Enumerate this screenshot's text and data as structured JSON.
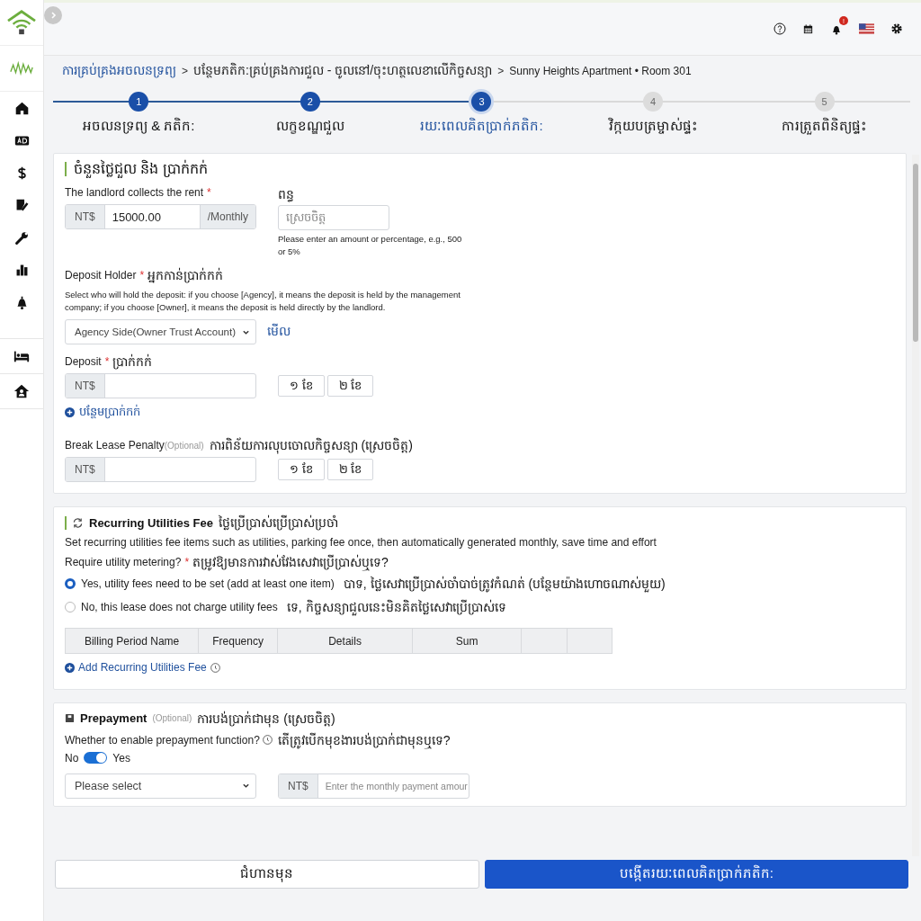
{
  "topbar": {
    "notification_badge": "!"
  },
  "breadcrumb": {
    "separator": ">",
    "items": [
      "ការគ្រប់គ្រងអចលនទ្រព្យ",
      "បន្ថែមភតិក:គ្រប់គ្រងការជួល - ចូលនៅ/ចុះហត្ថលេខាលើកិច្ចសន្យា",
      "Sunny Heights Apartment • Room 301"
    ]
  },
  "steps": [
    {
      "number": "1",
      "label": "អចលនទ្រព្យ & ភតិក:",
      "completed": true,
      "selected": false
    },
    {
      "number": "2",
      "label": "លក្ខខណ្ឌជួល",
      "completed": true,
      "selected": false
    },
    {
      "number": "3",
      "label": "រយៈពេលគិតប្រាក់ភតិក:",
      "completed": true,
      "selected": true
    },
    {
      "number": "4",
      "label": "វិក្កយបត្រម្ចាស់ផ្ទះ",
      "completed": false,
      "selected": false
    },
    {
      "number": "5",
      "label": "ការត្រួតពិនិត្យផ្ទះ",
      "completed": false,
      "selected": false
    }
  ],
  "rent_section": {
    "title": "ចំនួនថ្លៃជួល និង ប្រាក់កក់",
    "rent": {
      "label": "The landlord collects the rent",
      "mark": "*",
      "prefix": "NT$",
      "value": "15000.00",
      "suffix": "/Monthly"
    },
    "tax": {
      "label": "ពន្ធ",
      "placeholder": "ស្រេចចិត្ត",
      "hint": "Please enter an amount or percentage, e.g., 500 or 5%"
    },
    "deposit_holder": {
      "label": "Deposit Holder",
      "mark": "*",
      "label_km": "អ្នកកាន់ប្រាក់កក់",
      "description": "Select who will hold the deposit: if you choose [Agency], it means the deposit is held by the management company; if you choose [Owner], it means the deposit is held directly by the landlord.",
      "value": "Agency Side(Owner Trust Account)",
      "link": "មើល"
    },
    "deposit": {
      "label": "Deposit",
      "mark": "*",
      "label_km": "ប្រាក់កក់",
      "prefix": "NT$",
      "quick": [
        "១ ខែ",
        "២ ខែ"
      ],
      "add_link": "បន្ថែមប្រាក់កក់"
    },
    "penalty": {
      "label": "Break Lease Penalty",
      "optional": "(Optional)",
      "label_km": "ការពិន័យការលុបចោលកិច្ចសន្យា (ស្រេចចិត្ត)",
      "prefix": "NT$",
      "quick": [
        "១ ខែ",
        "២ ខែ"
      ]
    }
  },
  "utilities_section": {
    "title": "Recurring Utilities Fee",
    "title_km": "ថ្លៃប្រើប្រាស់ប្រើប្រាស់ប្រចាំ",
    "description": "Set recurring utilities fee items such as utilities, parking fee once, then automatically generated monthly, save time and effort",
    "question": {
      "label": "Require utility metering?",
      "mark": "*",
      "label_km": "តម្រូវឱ្យមានការវាស់វែងសេវាប្រើប្រាស់ឬទេ?"
    },
    "options": [
      {
        "label": "Yes, utility fees need to be set (add at least one item)",
        "label_km": "បាទ, ថ្លៃសេវាប្រើប្រាស់ចាំបាច់ត្រូវកំណត់ (បន្ថែមយ៉ាងហោចណាស់មួយ)",
        "selected": true
      },
      {
        "label": "No, this lease does not charge utility fees",
        "label_km": "ទេ, កិច្ចសន្យាជួលនេះមិនគិតថ្លៃសេវាប្រើប្រាស់ទេ",
        "selected": false
      }
    ],
    "table": {
      "columns": [
        "Billing Period Name",
        "Frequency",
        "Details",
        "Sum"
      ]
    },
    "add_link": "Add Recurring Utilities Fee"
  },
  "prepayment_section": {
    "title": "Prepayment",
    "optional": "(Optional)",
    "title_km": "ការបង់ប្រាក់ជាមុន (ស្រេចចិត្ត)",
    "question": {
      "label": "Whether to enable prepayment function?",
      "label_km": "តើត្រូវបើកមុខងារបង់ប្រាក់ជាមុនឬទេ?"
    },
    "toggle": {
      "off_label": "No",
      "on_label": "Yes",
      "on": true
    },
    "period_select": {
      "value": "Please select"
    },
    "amount": {
      "prefix": "NT$",
      "placeholder": "Enter the monthly payment amour"
    }
  },
  "footer": {
    "back_button": "ជំហានមុន",
    "submit_button": "បង្កើតរយៈពេលគិតប្រាក់ភតិក:"
  }
}
